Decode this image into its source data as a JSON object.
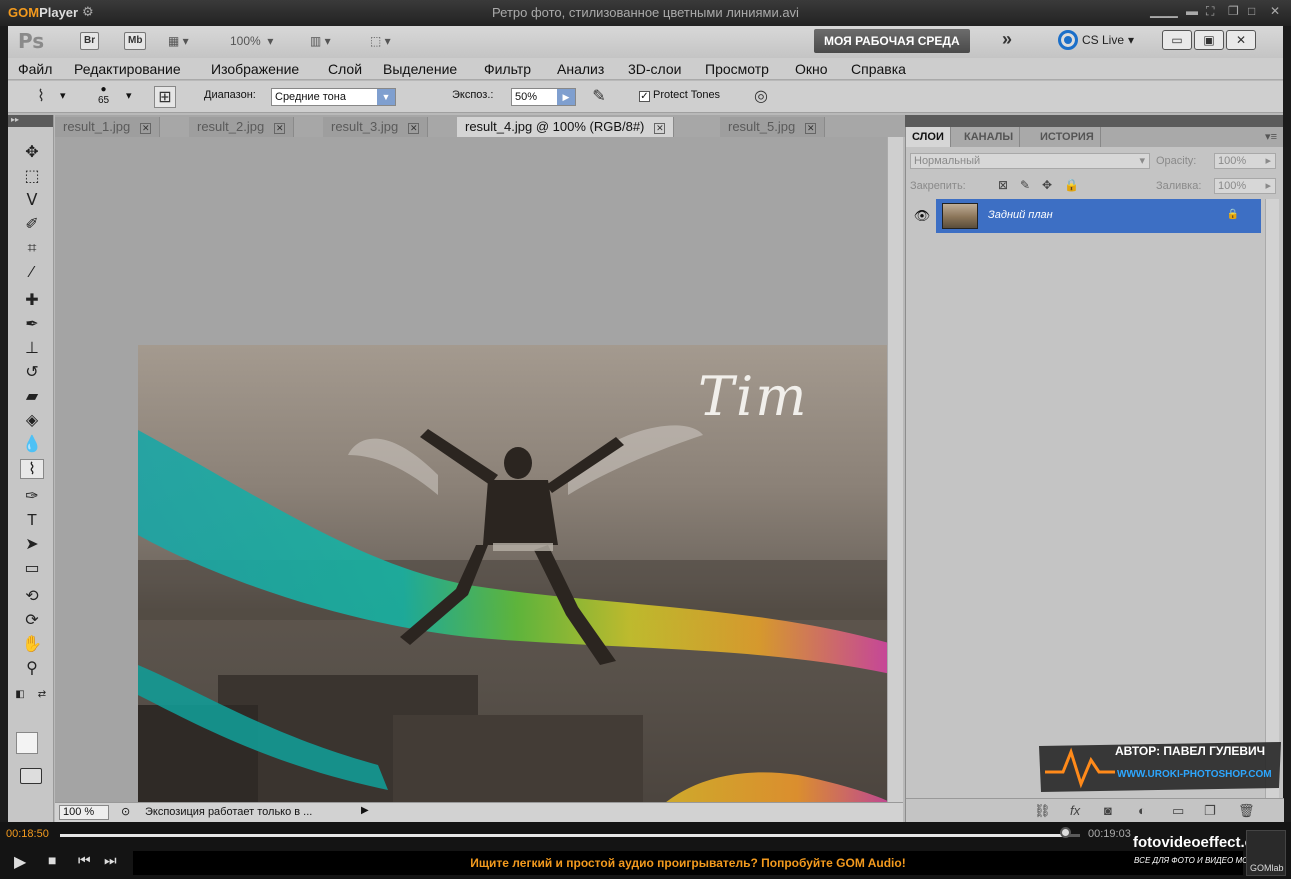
{
  "gom": {
    "logo": "GOM",
    "logo_player": "Player",
    "window_title": "Ретро фото, стилизованное цветными линиями.avi",
    "time_current": "00:18:50",
    "time_total": "00:19:03",
    "progress": 0.989,
    "marquee": "Ищите легкий и простой аудио проигрыватель? Попробуйте GOM Audio!",
    "gomlab_label": "GOMlab"
  },
  "photoshop": {
    "logo": "Ps",
    "bridge": "Br",
    "minibridge": "Mb",
    "zoom_level": "100%",
    "workspace_button": "МОЯ РАБОЧАЯ СРЕДА",
    "cs_live": "CS Live",
    "menu": [
      "Файл",
      "Редактирование",
      "Изображение",
      "Слой",
      "Выделение",
      "Фильтр",
      "Анализ",
      "3D-слои",
      "Просмотр",
      "Окно",
      "Справка"
    ],
    "options": {
      "brush_size": "65",
      "range_label": "Диапазон:",
      "range_value": "Средние тона",
      "exposure_label": "Экспоз.:",
      "exposure_value": "50%",
      "protect_tones": "Protect Tones"
    },
    "tabs": [
      {
        "label": "result_1.jpg",
        "active": false
      },
      {
        "label": "result_2.jpg",
        "active": false
      },
      {
        "label": "result_3.jpg",
        "active": false
      },
      {
        "label": "result_4.jpg @ 100% (RGB/8#)",
        "active": true
      },
      {
        "label": "result_5.jpg",
        "active": false
      }
    ],
    "status": {
      "zoom": "100 %",
      "message": "Экспозиция работает только в ..."
    },
    "photo_text": "Tim",
    "layers_panel": {
      "tabs": [
        "СЛОИ",
        "КАНАЛЫ",
        "ИСТОРИЯ"
      ],
      "blend_mode": "Нормальный",
      "opacity_label": "Opacity:",
      "opacity_value": "100%",
      "lock_label": "Закрепить:",
      "fill_label": "Заливка:",
      "fill_value": "100%",
      "layer_name": "Задний план"
    }
  },
  "watermark": {
    "author": "АВТОР: ПАВЕЛ ГУЛЕВИЧ",
    "site": "WWW.UROKI-PHOTOSHOP.COM"
  },
  "brand": {
    "site": "fotovideoeffect.com",
    "tagline": "ВСЕ ДЛЯ ФОТО И ВИДЕО МОНТАЖА!"
  }
}
